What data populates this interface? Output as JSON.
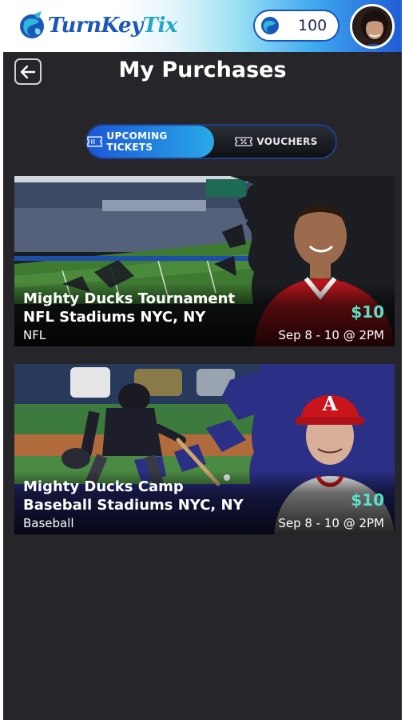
{
  "header": {
    "logo_part1": "TurnKey",
    "logo_part2": "Tix",
    "coin_balance": "100",
    "avatar_icon": "user-avatar"
  },
  "page": {
    "title": "My Purchases",
    "back_icon": "arrow-left-icon"
  },
  "tabs": [
    {
      "label": "UPCOMING TICKETS",
      "icon": "ticket-icon",
      "active": true
    },
    {
      "label": "VOUCHERS",
      "icon": "voucher-icon",
      "active": false
    }
  ],
  "purchases": [
    {
      "title_line1": "Mighty Ducks Tournament",
      "title_line2": "NFL Stadiums NYC, NY",
      "category": "NFL",
      "price": "$10",
      "date": "Sep 8 - 10 @ 2PM"
    },
    {
      "title_line1": "Mighty Ducks Camp",
      "title_line2": "Baseball Stadiums NYC, NY",
      "category": "Baseball",
      "price": "$10",
      "date": "Sep 8 - 10 @ 2PM"
    }
  ],
  "colors": {
    "accent_blue": "#1b56d6",
    "accent_cyan": "#2aa9e8",
    "price_teal": "#57e0c8",
    "background": "#26262a"
  }
}
